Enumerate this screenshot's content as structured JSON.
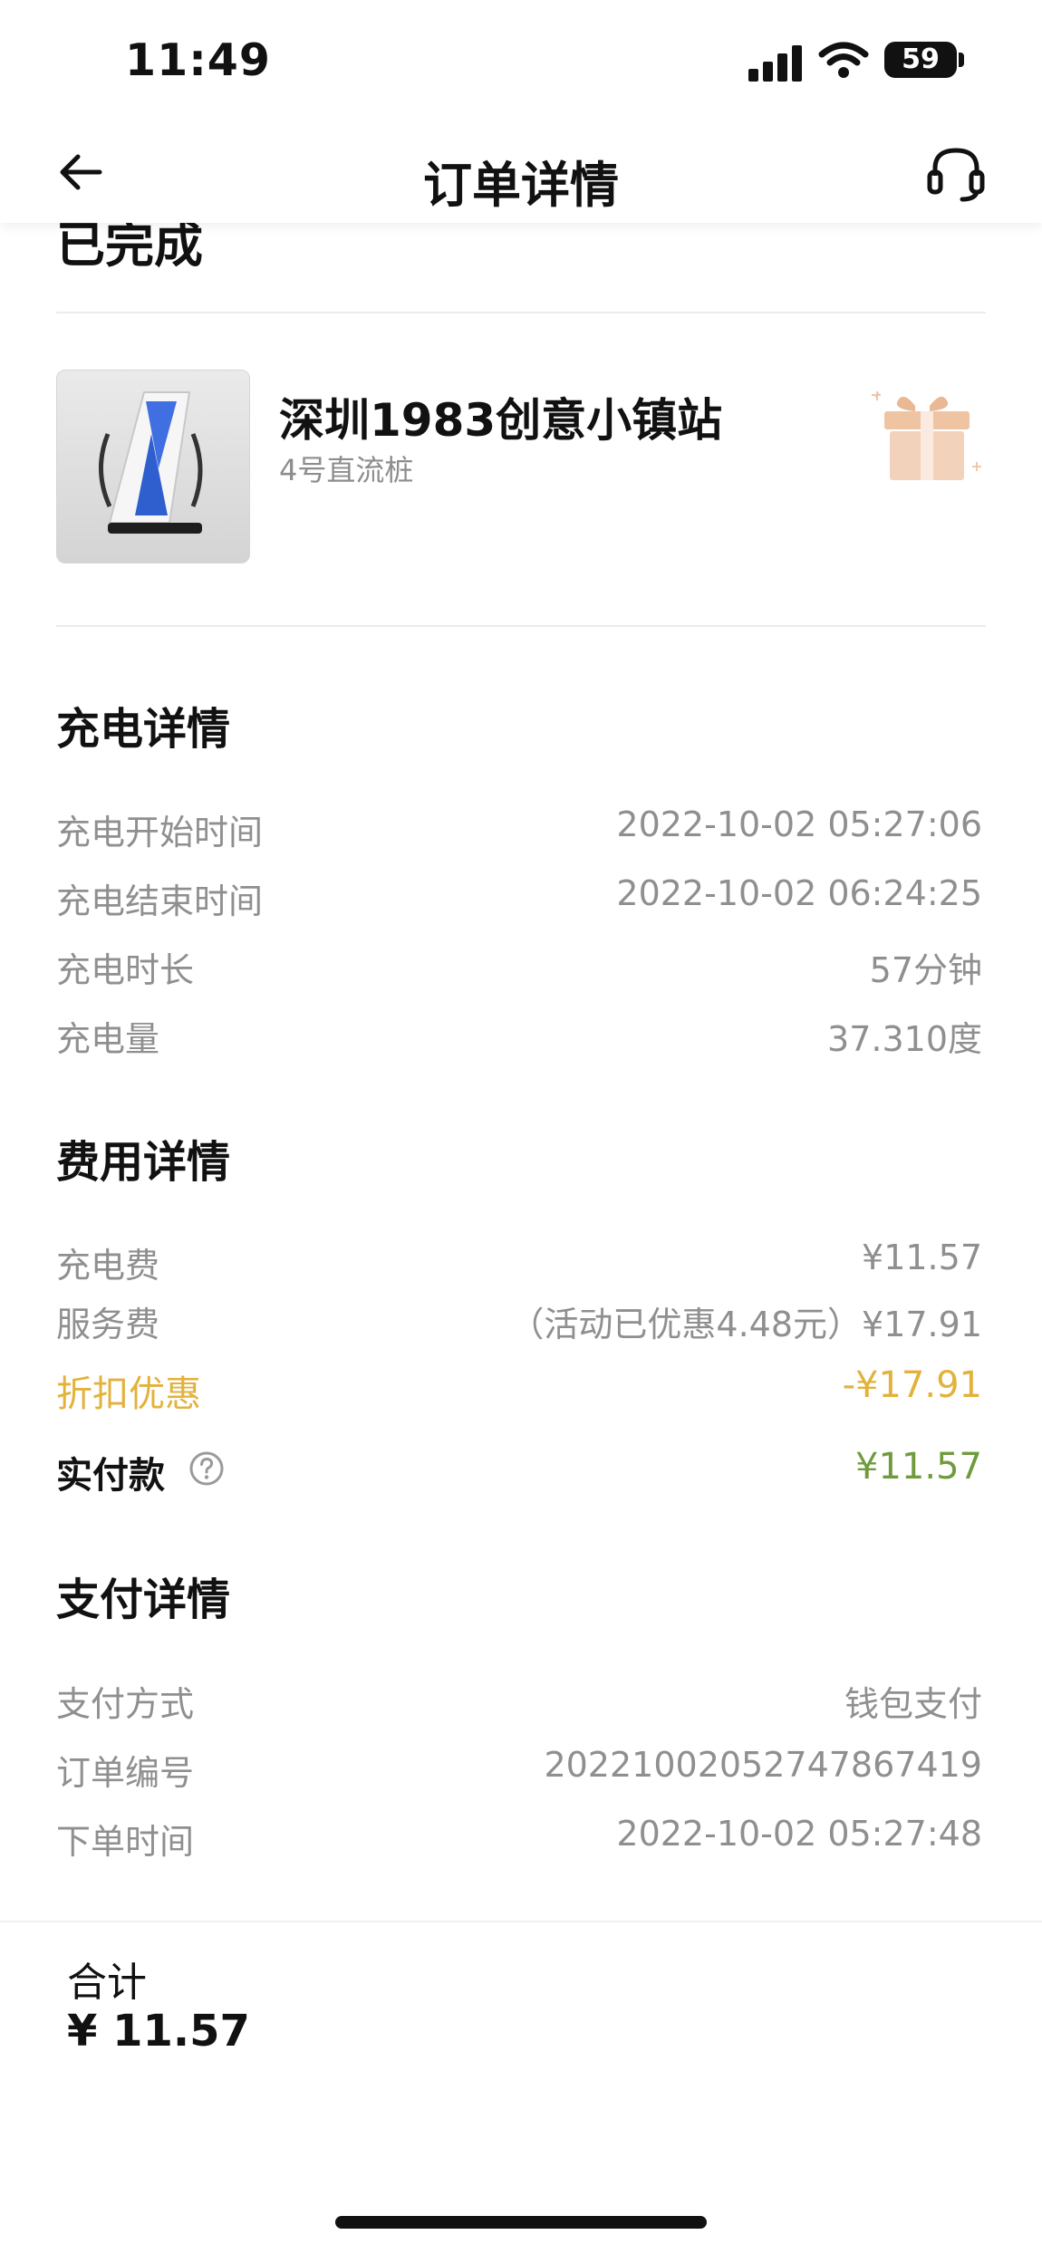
{
  "status_bar": {
    "time": "11:49",
    "battery": "59"
  },
  "nav": {
    "title": "订单详情"
  },
  "hidden_heading": "已完成",
  "station": {
    "name": "深圳1983创意小镇站",
    "pile": "4号直流桩"
  },
  "charging": {
    "title": "充电详情",
    "rows": [
      {
        "label": "充电开始时间",
        "value": "2022-10-02 05:27:06"
      },
      {
        "label": "充电结束时间",
        "value": "2022-10-02 06:24:25"
      },
      {
        "label": "充电时长",
        "value": "57分钟"
      },
      {
        "label": "充电量",
        "value": "37.310度"
      }
    ]
  },
  "fees": {
    "title": "费用详情",
    "charge_fee": {
      "label": "充电费",
      "value": "¥11.57"
    },
    "service_fee": {
      "label": "服务费",
      "value": "（活动已优惠4.48元）¥17.91"
    },
    "discount": {
      "label": "折扣优惠",
      "value": "-¥17.91"
    },
    "paid": {
      "label": "实付款",
      "value": "¥11.57"
    }
  },
  "payment": {
    "title": "支付详情",
    "rows": [
      {
        "label": "支付方式",
        "value": "钱包支付"
      },
      {
        "label": "订单编号",
        "value": "20221002052747867419"
      },
      {
        "label": "下单时间",
        "value": "2022-10-02 05:27:48"
      }
    ]
  },
  "footer": {
    "total_label": "合计",
    "total_value": "¥ 11.57"
  },
  "colors": {
    "discount": "#e2b23c",
    "paid": "#6f9b3d",
    "muted": "#8f8f8f"
  },
  "icons": [
    "back-arrow-icon",
    "headset-icon",
    "gift-icon",
    "help-icon",
    "signal-icon",
    "wifi-icon",
    "battery-icon"
  ]
}
